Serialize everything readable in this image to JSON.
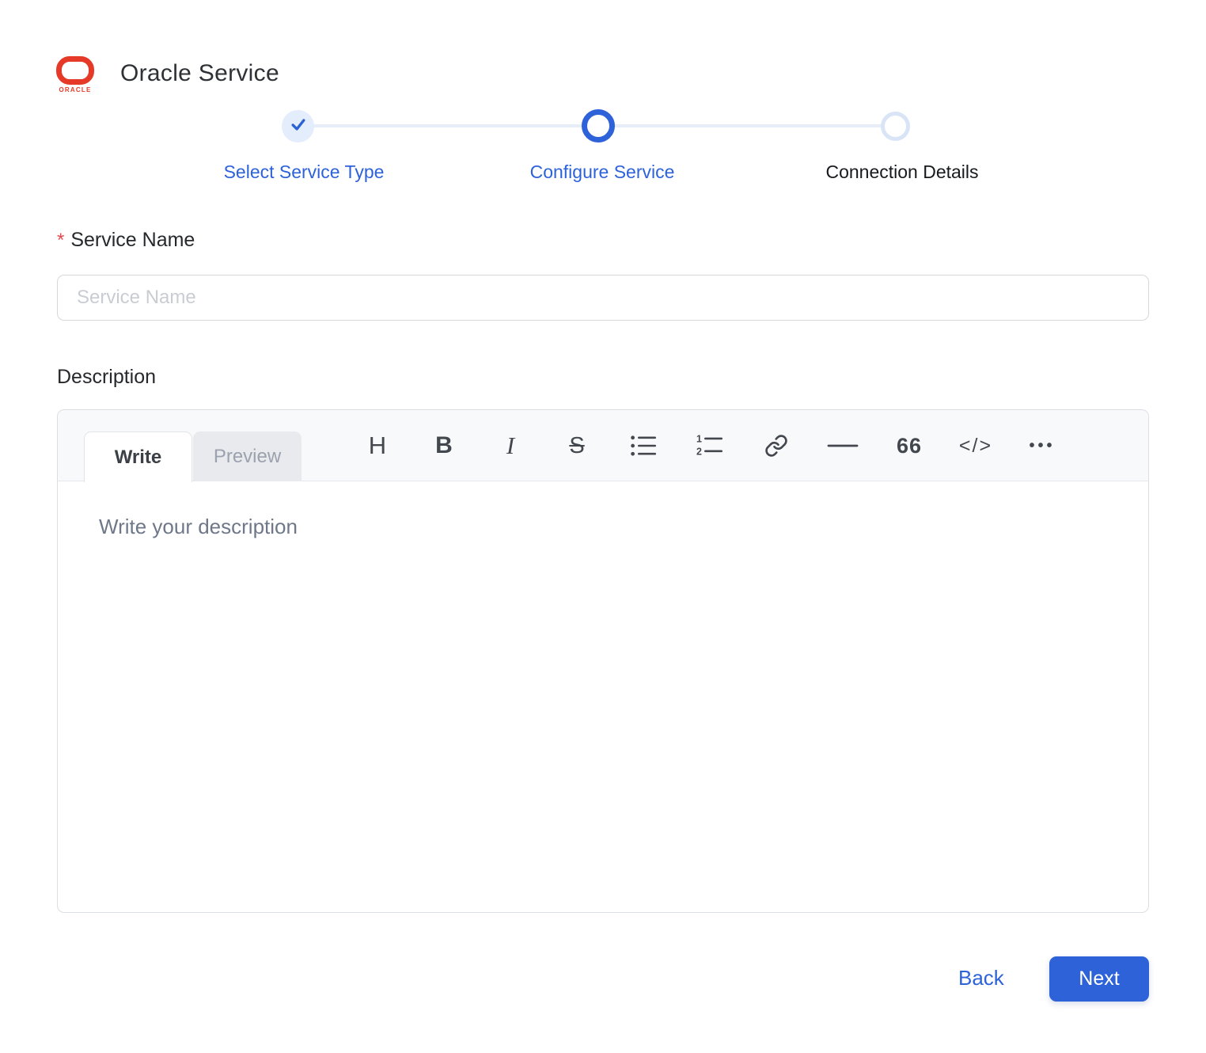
{
  "header": {
    "title": "Oracle Service",
    "logo_text": "ORACLE"
  },
  "stepper": {
    "steps": [
      {
        "label": "Select Service Type",
        "state": "completed"
      },
      {
        "label": "Configure Service",
        "state": "active"
      },
      {
        "label": "Connection Details",
        "state": "upcoming"
      }
    ]
  },
  "form": {
    "service_name": {
      "label": "Service Name",
      "required_marker": "*",
      "placeholder": "Service Name",
      "value": ""
    },
    "description": {
      "label": "Description",
      "tabs": [
        {
          "label": "Write",
          "active": true
        },
        {
          "label": "Preview",
          "active": false
        }
      ],
      "placeholder": "Write your description",
      "value": "",
      "toolbar": [
        {
          "name": "heading",
          "glyph": "H"
        },
        {
          "name": "bold",
          "glyph": "B"
        },
        {
          "name": "italic",
          "glyph": "I"
        },
        {
          "name": "strikethrough",
          "glyph": "S"
        },
        {
          "name": "unordered-list"
        },
        {
          "name": "ordered-list"
        },
        {
          "name": "link"
        },
        {
          "name": "horizontal-rule"
        },
        {
          "name": "quote",
          "glyph": "66"
        },
        {
          "name": "code",
          "glyph": "</>"
        },
        {
          "name": "more",
          "glyph": "•••"
        }
      ]
    }
  },
  "footer": {
    "back_label": "Back",
    "next_label": "Next"
  },
  "colors": {
    "accent_blue": "#2e62d9",
    "step_done_bg": "#e3edfb",
    "step_upcoming_ring": "#d9e5f6",
    "connector": "#e8eef9",
    "required_red": "#e5484d",
    "oracle_red": "#e53a28",
    "editor_header_bg": "#f8f9fb",
    "preview_tab_bg": "#e9eaee"
  }
}
